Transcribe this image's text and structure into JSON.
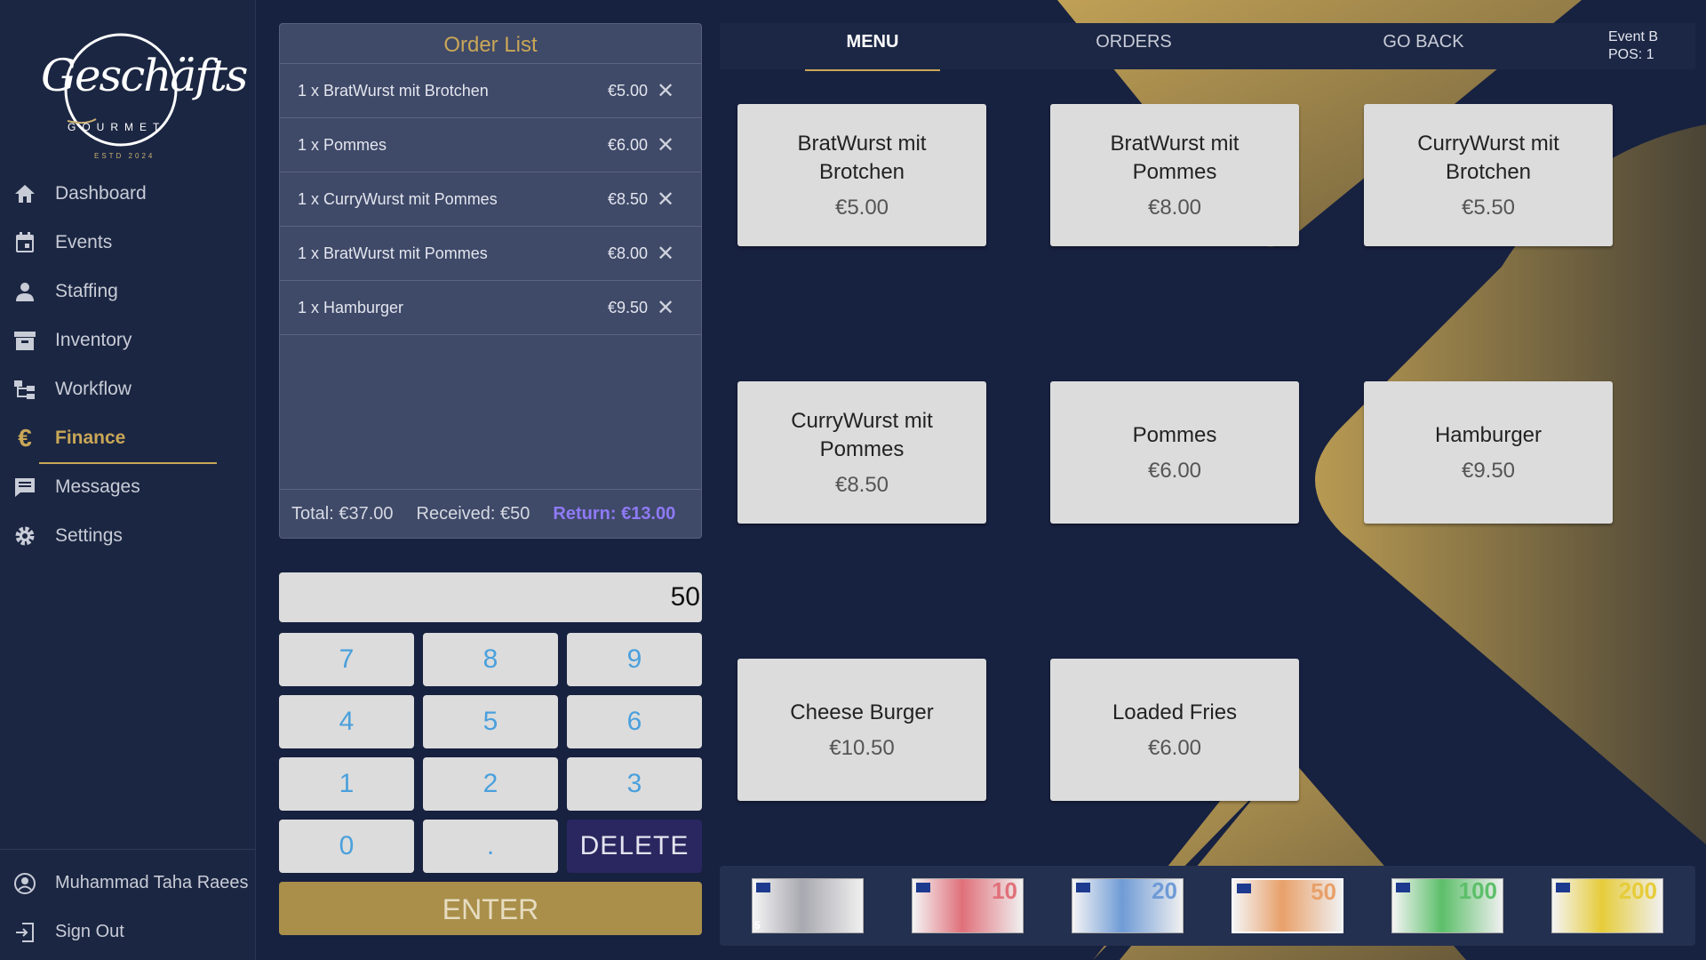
{
  "sidebar": {
    "logo": {
      "script": "Geschäfts",
      "gourmet": "GOURMET",
      "estd": "ESTD 2024"
    },
    "items": [
      {
        "label": "Dashboard",
        "icon": "home-icon"
      },
      {
        "label": "Events",
        "icon": "calendar-icon"
      },
      {
        "label": "Staffing",
        "icon": "person-icon"
      },
      {
        "label": "Inventory",
        "icon": "archive-icon"
      },
      {
        "label": "Workflow",
        "icon": "workflow-icon"
      },
      {
        "label": "Finance",
        "icon": "euro-icon",
        "active": true
      },
      {
        "label": "Messages",
        "icon": "message-icon"
      },
      {
        "label": "Settings",
        "icon": "gear-icon"
      }
    ],
    "user": "Muhammad Taha Raees",
    "sign_out": "Sign Out"
  },
  "order": {
    "title": "Order List",
    "items": [
      {
        "name": "1 x BratWurst mit Brotchen",
        "price": "€5.00"
      },
      {
        "name": "1 x Pommes",
        "price": "€6.00"
      },
      {
        "name": "1 x CurryWurst mit Pommes",
        "price": "€8.50"
      },
      {
        "name": "1 x BratWurst mit Pommes",
        "price": "€8.00"
      },
      {
        "name": "1 x Hamburger",
        "price": "€9.50"
      }
    ],
    "total": "Total: €37.00",
    "received": "Received: €50",
    "return": "Return: €13.00"
  },
  "keypad": {
    "display": "50",
    "keys": [
      "7",
      "8",
      "9",
      "4",
      "5",
      "6",
      "1",
      "2",
      "3",
      "0",
      ".",
      "DELETE"
    ],
    "enter": "ENTER"
  },
  "topbar": {
    "tabs": [
      "MENU",
      "ORDERS",
      "GO BACK"
    ],
    "event": "Event B",
    "pos": "POS: 1"
  },
  "menu": [
    {
      "name": "BratWurst mit Brotchen",
      "price": "€5.00"
    },
    {
      "name": "BratWurst mit Pommes",
      "price": "€8.00"
    },
    {
      "name": "CurryWurst mit Brotchen",
      "price": "€5.50"
    },
    {
      "name": "CurryWurst mit Pommes",
      "price": "€8.50"
    },
    {
      "name": "Pommes",
      "price": "€6.00"
    },
    {
      "name": "Hamburger",
      "price": "€9.50"
    },
    {
      "name": "Cheese Burger",
      "price": "€10.50"
    },
    {
      "name": "Loaded Fries",
      "price": "€6.00"
    }
  ],
  "banknotes": [
    {
      "value": "5",
      "color": "#a8a8b0",
      "selected": false
    },
    {
      "value": "10",
      "color": "#e0707a",
      "selected": false
    },
    {
      "value": "20",
      "color": "#6f9bd6",
      "selected": false
    },
    {
      "value": "50",
      "color": "#e8a06a",
      "selected": true
    },
    {
      "value": "100",
      "color": "#5cbf6a",
      "selected": false
    },
    {
      "value": "200",
      "color": "#e6cc3a",
      "selected": false
    }
  ],
  "colors": {
    "accent": "#c9a757",
    "return": "#8e7af5",
    "background": "#172140"
  }
}
